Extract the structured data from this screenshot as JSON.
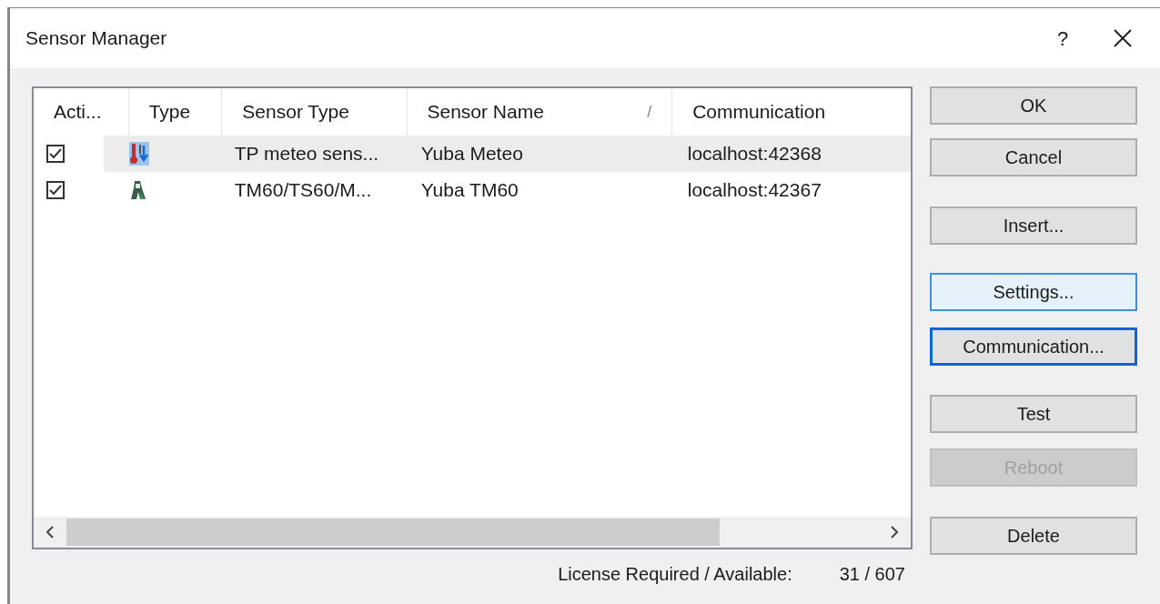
{
  "window": {
    "title": "Sensor Manager",
    "help": "?"
  },
  "table": {
    "columns": [
      {
        "label": "Acti..."
      },
      {
        "label": "Type"
      },
      {
        "label": "Sensor Type"
      },
      {
        "label": "Sensor Name",
        "sort_mark": "/"
      },
      {
        "label": "Communication"
      }
    ],
    "rows": [
      {
        "checked": true,
        "selected": true,
        "kind": "meteo",
        "sensor_type": "TP meteo sens...",
        "sensor_name": "Yuba Meteo",
        "communication": "localhost:42368"
      },
      {
        "checked": true,
        "selected": false,
        "kind": "station",
        "sensor_type": "TM60/TS60/M...",
        "sensor_name": "Yuba TM60",
        "communication": "localhost:42367"
      }
    ]
  },
  "buttons": [
    {
      "label": "OK",
      "disabled": false,
      "hovered": false,
      "focused": false
    },
    {
      "label": "Cancel",
      "disabled": false,
      "hovered": false,
      "focused": false
    },
    {
      "label": "Insert...",
      "disabled": false,
      "hovered": false,
      "focused": false
    },
    {
      "label": "Settings...",
      "disabled": false,
      "hovered": true,
      "focused": false
    },
    {
      "label": "Communication...",
      "disabled": false,
      "hovered": false,
      "focused": true
    },
    {
      "label": "Test",
      "disabled": false,
      "hovered": false,
      "focused": false
    },
    {
      "label": "Reboot",
      "disabled": true,
      "hovered": false,
      "focused": false
    },
    {
      "label": "Delete",
      "disabled": false,
      "hovered": false,
      "focused": false
    }
  ],
  "license": {
    "label": "License Required / Available:",
    "value": "31 / 607"
  }
}
